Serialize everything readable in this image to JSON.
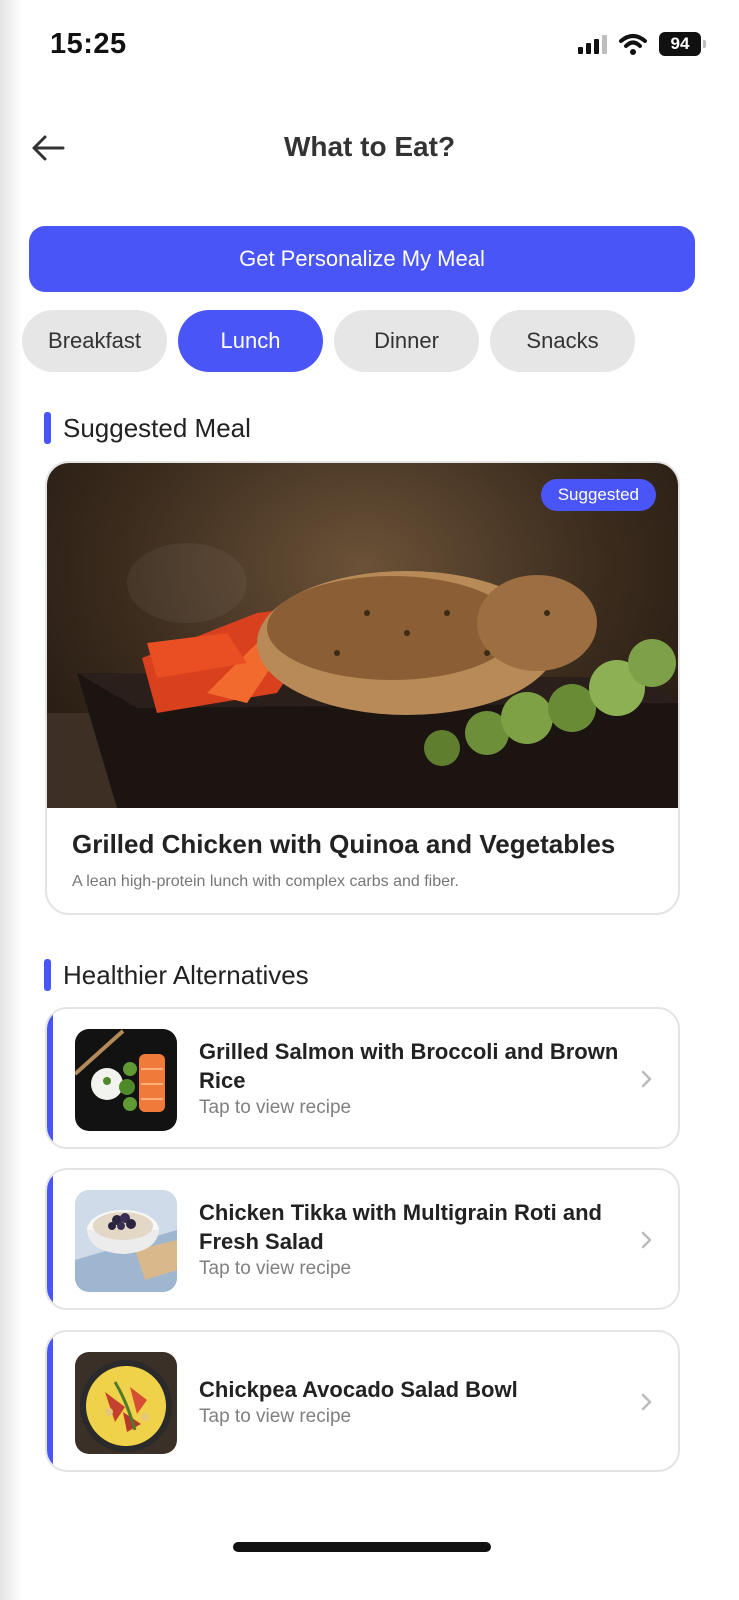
{
  "status_bar": {
    "time": "15:25",
    "battery": "94"
  },
  "header": {
    "title": "What to Eat?"
  },
  "primary_action": {
    "label": "Get Personalize My Meal"
  },
  "tabs": [
    {
      "label": "Breakfast",
      "active": false
    },
    {
      "label": "Lunch",
      "active": true
    },
    {
      "label": "Dinner",
      "active": false
    },
    {
      "label": "Snacks",
      "active": false
    }
  ],
  "suggested": {
    "section_title": "Suggested Meal",
    "badge": "Suggested",
    "name": "Grilled Chicken with Quinoa and Vegetables",
    "description": "A lean high-protein lunch with complex carbs and fiber."
  },
  "alternatives": {
    "section_title": "Healthier Alternatives",
    "items": [
      {
        "title": "Grilled Salmon with Broccoli and Brown Rice",
        "subtitle": "Tap to view recipe"
      },
      {
        "title": "Chicken Tikka with Multigrain Roti and Fresh Salad",
        "subtitle": "Tap to view recipe"
      },
      {
        "title": "Chickpea Avocado Salad Bowl",
        "subtitle": "Tap to view recipe"
      }
    ]
  },
  "colors": {
    "accent": "#4a55f7",
    "tab_inactive": "#e6e6e6"
  },
  "icons": [
    "back-arrow-icon",
    "signal-icon",
    "wifi-icon",
    "battery-icon",
    "chevron-right-icon"
  ]
}
